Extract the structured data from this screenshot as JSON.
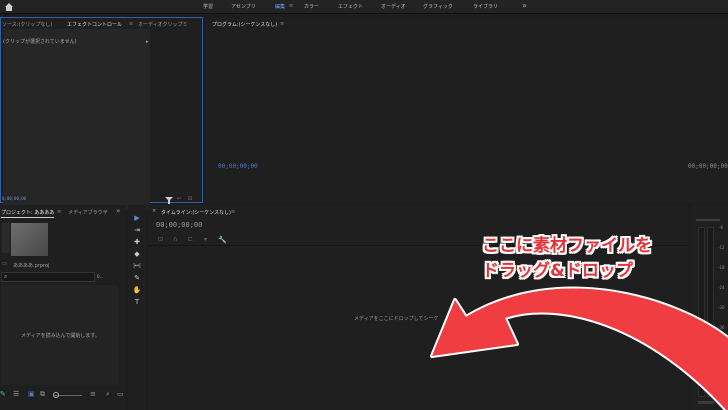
{
  "workspaces": [
    {
      "label": "学習",
      "active": false
    },
    {
      "label": "アセンブリ",
      "active": false
    },
    {
      "label": "編集",
      "active": true
    },
    {
      "label": "カラー",
      "active": false
    },
    {
      "label": "エフェクト",
      "active": false
    },
    {
      "label": "オーディオ",
      "active": false
    },
    {
      "label": "グラフィック",
      "active": false
    },
    {
      "label": "ライブラリ",
      "active": false
    }
  ],
  "effect_panel": {
    "tabs": [
      "ソース:(クリップなし)",
      "エフェクトコントロール",
      "オーディオクリップミ"
    ],
    "menu_glyph": "≡",
    "no_clip_text": "(クリップが選択されていません)",
    "timecode": "0;00;00;00"
  },
  "program_panel": {
    "title": "プログラム:(シーケンスなし)",
    "menu_glyph": "≡",
    "timecode_left": "00;00;00;00",
    "timecode_right": "00;00;00;00",
    "controls": [
      "⬩",
      "{",
      "}",
      "|◀",
      "◀|",
      "▶",
      "|▶",
      "▶|",
      "⏏",
      "⏏",
      "⊡",
      "⊡",
      "⊡",
      "⊡"
    ],
    "add_glyph": "+"
  },
  "project_panel": {
    "tabs": [
      "プロジェクト: ああああ",
      "メディアブラウザ"
    ],
    "menu_glyph": "≡",
    "more_glyph": "»",
    "thumbnail_name": "ああああ.prproj",
    "item_count": "0...",
    "empty_text": "メディアを読み込んで開始します。"
  },
  "tools": [
    "▶",
    "⇥",
    "✚",
    "◆",
    "|↔|",
    "✎",
    "✋",
    "T"
  ],
  "timeline_panel": {
    "close_glyph": "×",
    "title": "タイムライン:(シーケンスなし)",
    "menu_glyph": "≡",
    "timecode": "00;00;00;00",
    "drop_text": "メディアをここにドロップしてシーケ"
  },
  "meter": {
    "labels": [
      "-6",
      "-12",
      "-18",
      "-24",
      "-30",
      "-36",
      "-42",
      "-48",
      "-54",
      "dB"
    ]
  },
  "overlay": {
    "line1": "ここに素材ファイルを",
    "line2": "ドラッグ&ドロップ"
  },
  "colors": {
    "accent_blue": "#2f5fa8",
    "active_tab_blue": "#6aa6ff",
    "overlay_red": "#e8323a",
    "arrow_red": "#ef3d42"
  }
}
